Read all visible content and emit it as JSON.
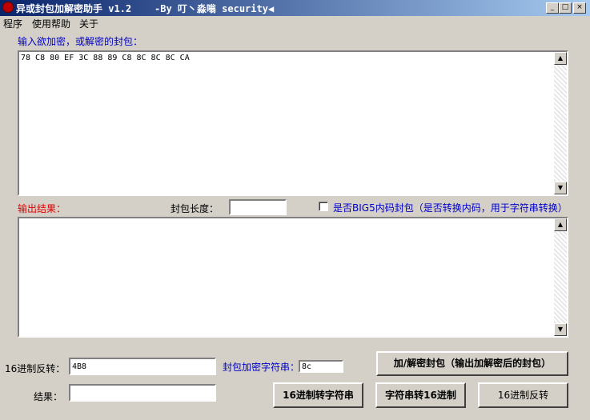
{
  "window": {
    "title": "异或封包加解密助手 v1.2    -By 叮丶淼嗡 security◀",
    "minimize": "_",
    "maximize": "□",
    "close": "×"
  },
  "menu": [
    "程序",
    "使用帮助",
    "关于"
  ],
  "input_label": "输入欲加密，或解密的封包：",
  "input_text": "78 C8 80 EF 3C 88 89 C8 8C 8C 8C CA",
  "output_label": "输出结果：",
  "length_label": "封包长度：",
  "length_value": "",
  "big5_label": "是否BIG5内码封包（是否转换内码，用于字符串转换）",
  "output_text": "",
  "hex_reverse_label": "16进制反转：",
  "hex_reverse_value": "4B8",
  "key_label": "封包加密字符串：",
  "key_value": "8c",
  "result_label": "结果：",
  "result_value": "",
  "buttons": {
    "encrypt": "加/解密封包（输出加解密后的封包）",
    "hex_to_str": "16进制转字符串",
    "str_to_hex": "字符串转16进制",
    "hex_reverse": "16进制反转"
  }
}
